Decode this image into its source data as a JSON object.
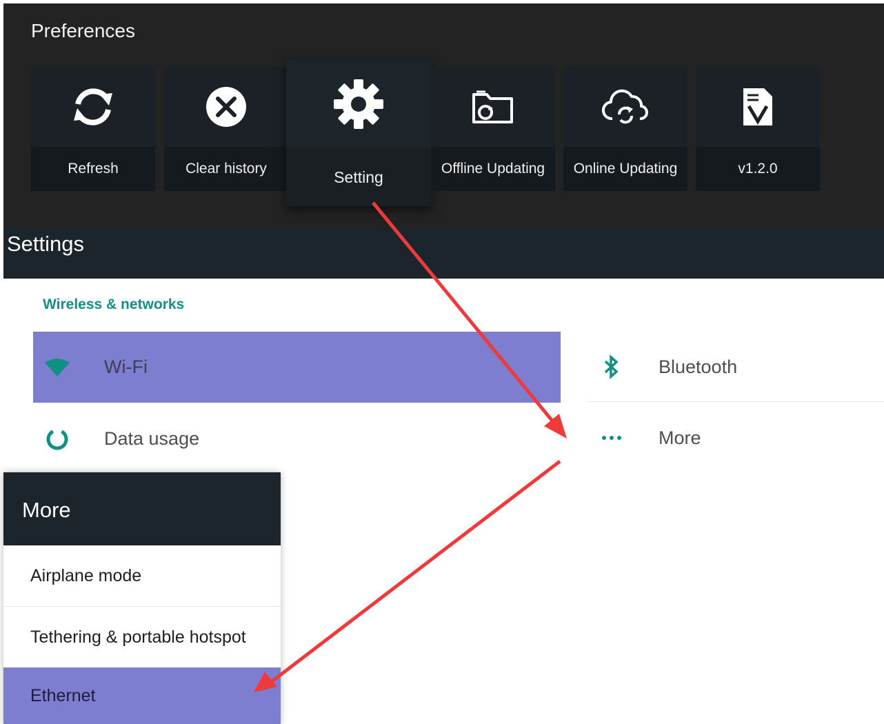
{
  "preferences": {
    "title": "Preferences",
    "tiles": [
      {
        "label": "Refresh",
        "icon": "refresh-icon"
      },
      {
        "label": "Clear history",
        "icon": "clear-circle-icon"
      },
      {
        "label": "Setting",
        "icon": "gear-icon"
      },
      {
        "label": "Offline Updating",
        "icon": "folder-sync-icon"
      },
      {
        "label": "Online Updating",
        "icon": "cloud-sync-icon"
      },
      {
        "label": "v1.2.0",
        "icon": "version-document-icon"
      }
    ],
    "active_tile": "Setting"
  },
  "settings": {
    "title": "Settings",
    "section": "Wireless & networks",
    "items": [
      {
        "label": "Wi-Fi",
        "icon": "wifi-icon"
      },
      {
        "label": "Bluetooth",
        "icon": "bluetooth-icon"
      },
      {
        "label": "Data usage",
        "icon": "data-usage-icon"
      },
      {
        "label": "More",
        "icon": "more-dots-icon"
      }
    ],
    "selected": "Wi-Fi"
  },
  "more_panel": {
    "title": "More",
    "items": [
      {
        "label": "Airplane mode"
      },
      {
        "label": "Tethering & portable hotspot"
      },
      {
        "label": "Ethernet"
      }
    ],
    "selected": "Ethernet"
  },
  "colors": {
    "accent_teal": "#119185",
    "highlight_purple": "#7e7ed1",
    "arrow_red": "#ee3a3a",
    "dark_bg": "#232323"
  }
}
